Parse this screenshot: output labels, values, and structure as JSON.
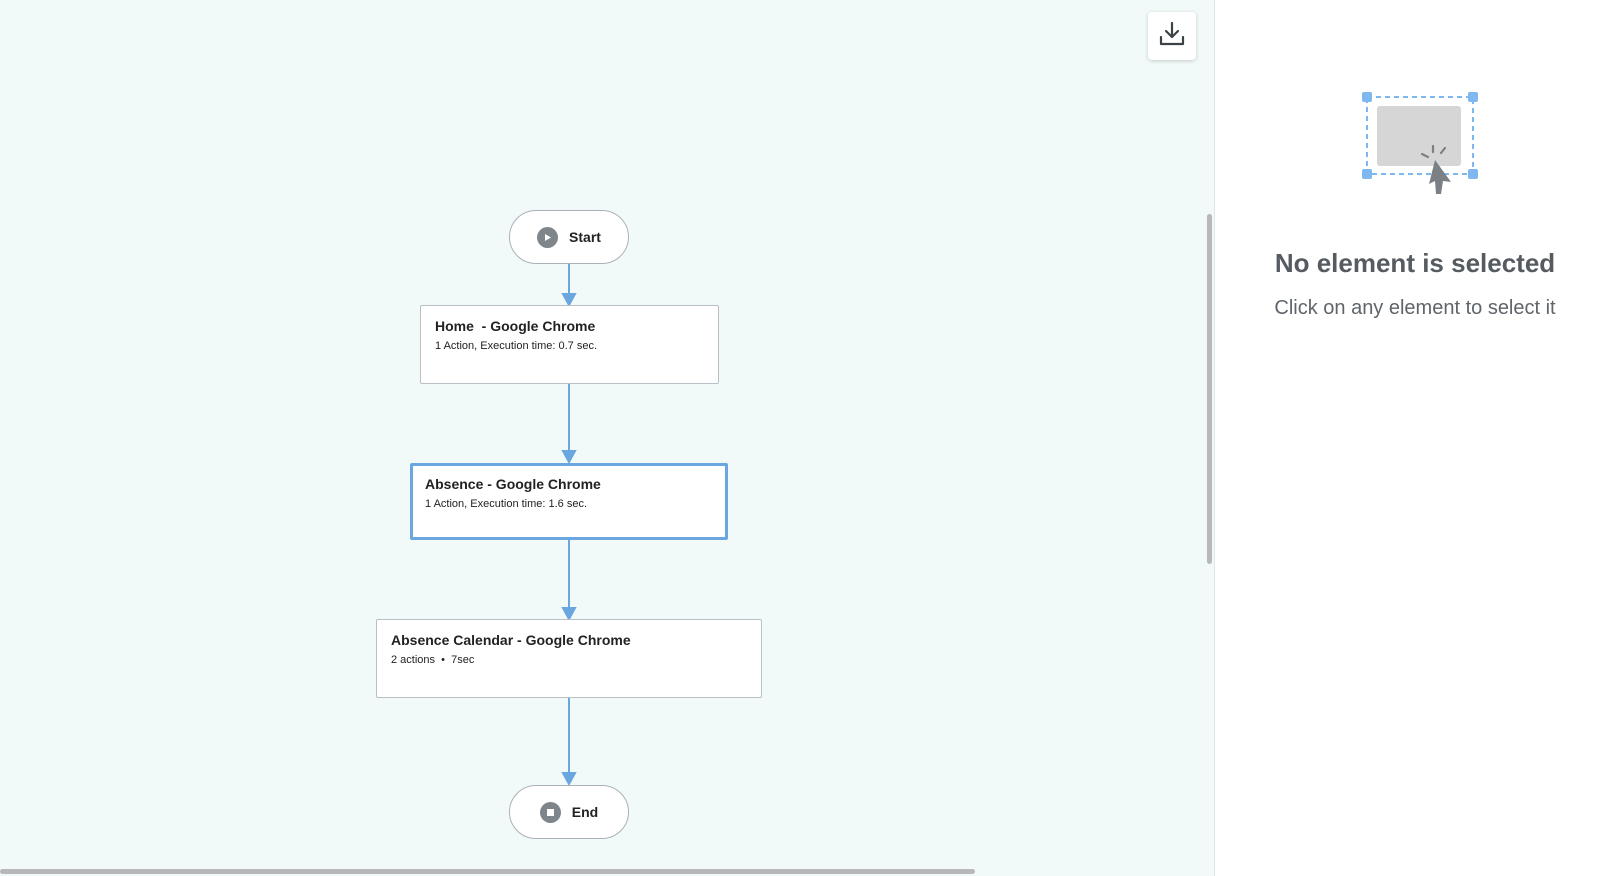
{
  "canvas": {
    "background": "#f2f9f9",
    "connector_color": "#6aa6e0",
    "export_button": {
      "icon": "download-icon"
    }
  },
  "flow": {
    "start": {
      "label": "Start",
      "icon": "play-icon"
    },
    "steps": [
      {
        "title": "Home  - Google Chrome",
        "meta": "1 Action, Execution time: 0.7 sec.",
        "selected": false
      },
      {
        "title": "Absence - Google Chrome",
        "meta": "1 Action, Execution time: 1.6 sec.",
        "selected": true
      },
      {
        "title": "Absence Calendar - Google Chrome",
        "meta": "2 actions  •  7sec",
        "selected": false
      }
    ],
    "end": {
      "label": "End",
      "icon": "stop-icon"
    }
  },
  "side_panel": {
    "empty_title": "No element is selected",
    "empty_subtitle": "Click on any element to select it",
    "illustration": "selection-cursor-icon",
    "accent": "#7fb8ee"
  }
}
